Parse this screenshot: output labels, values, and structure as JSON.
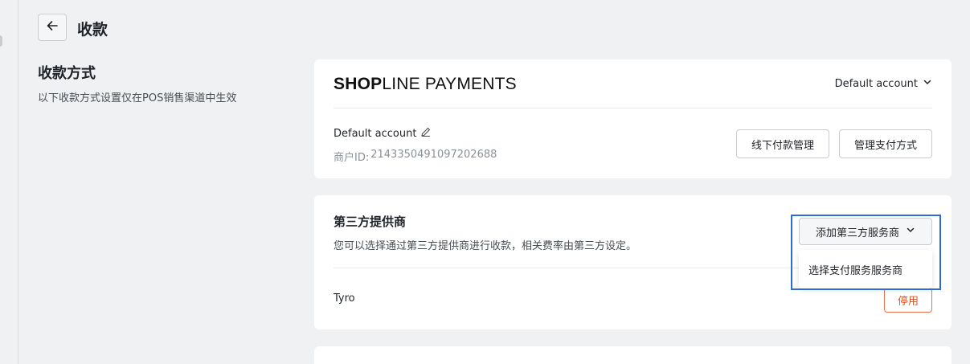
{
  "header": {
    "title": "收款"
  },
  "section": {
    "title": "收款方式",
    "description": "以下收款方式设置仅在POS销售渠道中生效"
  },
  "shopline_card": {
    "logo_bold": "SHOP",
    "logo_light": "LINE PAYMENTS",
    "account_dropdown": "Default account",
    "account_name": "Default account",
    "merchant_id_label": "商户ID:",
    "merchant_id_value": "2143350491097202688",
    "offline_button": "线下付款管理",
    "manage_button": "管理支付方式"
  },
  "third_party": {
    "title": "第三方提供商",
    "description": "您可以选择通过第三方提供商进行收款，相关费率由第三方设定。",
    "add_button": "添加第三方服务商",
    "dropdown_option": "选择支付服务服务商",
    "providers": [
      {
        "name": "Tyro",
        "action": "停用"
      }
    ]
  },
  "colors": {
    "background": "#f0f1f3",
    "card": "#ffffff",
    "disable": "#e0531f",
    "highlight": "#2f6bd8"
  }
}
